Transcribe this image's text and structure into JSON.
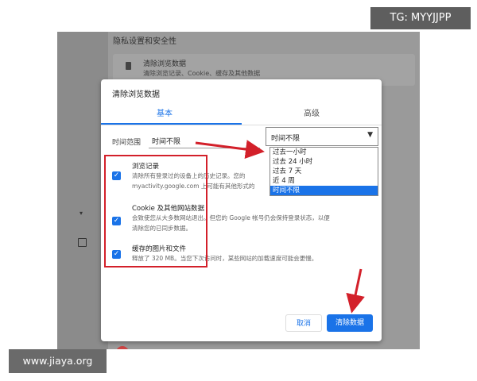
{
  "background": {
    "section_title": "隐私设置和安全性",
    "row_title": "清除浏览数据",
    "row_subtitle": "清除浏览记录、Cookie、缓存及其他数据"
  },
  "dialog": {
    "title": "清除浏览数据",
    "tabs": [
      {
        "label": "基本",
        "active": true
      },
      {
        "label": "高级",
        "active": false
      }
    ],
    "time_range_label": "时间范围",
    "time_range_value": "时间不限",
    "items": [
      {
        "title": "浏览记录",
        "desc1": "清除所有登录过的设备上的历史记录。您的",
        "desc2": "myactivity.google.com 上可能有其他形式的",
        "checked": true
      },
      {
        "title": "Cookie 及其他网站数据",
        "desc1": "会致使您从大多数网站退出。但您的 Google 帐号仍会保持登录状态，以便",
        "desc2": "清除您的已同步数据。",
        "checked": true
      },
      {
        "title": "缓存的图片和文件",
        "desc1": "释放了 320 MB。当您下次访问时，某些网站的加载速度可能会更慢。",
        "checked": true
      }
    ],
    "cancel_label": "取消",
    "clear_label": "清除数据"
  },
  "dropdown": {
    "value": "时间不限",
    "options": [
      "过去一小时",
      "过去 24 小时",
      "过去 7 天",
      "近 4 周",
      "时间不限"
    ],
    "selected_index": 4
  },
  "watermarks": {
    "top_right": "TG: MYYJJPP",
    "bottom_left": "www.jiaya.org"
  },
  "colors": {
    "accent": "#1a73e8",
    "annotation_red": "#d3202a"
  }
}
